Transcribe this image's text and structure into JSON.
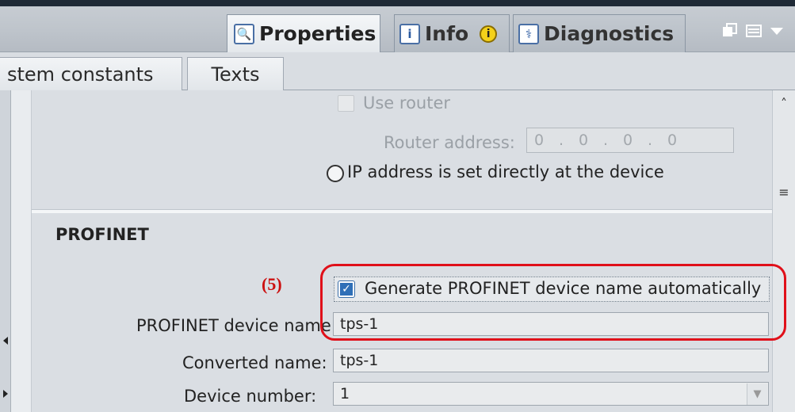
{
  "tabs": {
    "properties": "Properties",
    "info": "Info",
    "info_badge": "i",
    "diagnostics": "Diagnostics"
  },
  "subtabs": {
    "system_constants": "stem constants",
    "texts": "Texts"
  },
  "ip_section": {
    "use_router_label": "Use router",
    "use_router_checked": false,
    "router_address_label": "Router address:",
    "router_address_octets": [
      "0",
      "0",
      "0",
      "0"
    ],
    "ip_set_directly_label": "IP address is set directly at the device"
  },
  "profinet": {
    "heading": "PROFINET",
    "step_annotation": "(5)",
    "generate_name_label": "Generate PROFINET device name automatically",
    "generate_name_checked": true,
    "device_name_label": "PROFINET device name",
    "device_name_value": "tps-1",
    "converted_name_label": "Converted name:",
    "converted_name_value": "tps-1",
    "device_number_label": "Device number:",
    "device_number_value": "1"
  },
  "colors": {
    "highlight": "#e0101a",
    "checkbox_blue": "#2f6fb7"
  }
}
